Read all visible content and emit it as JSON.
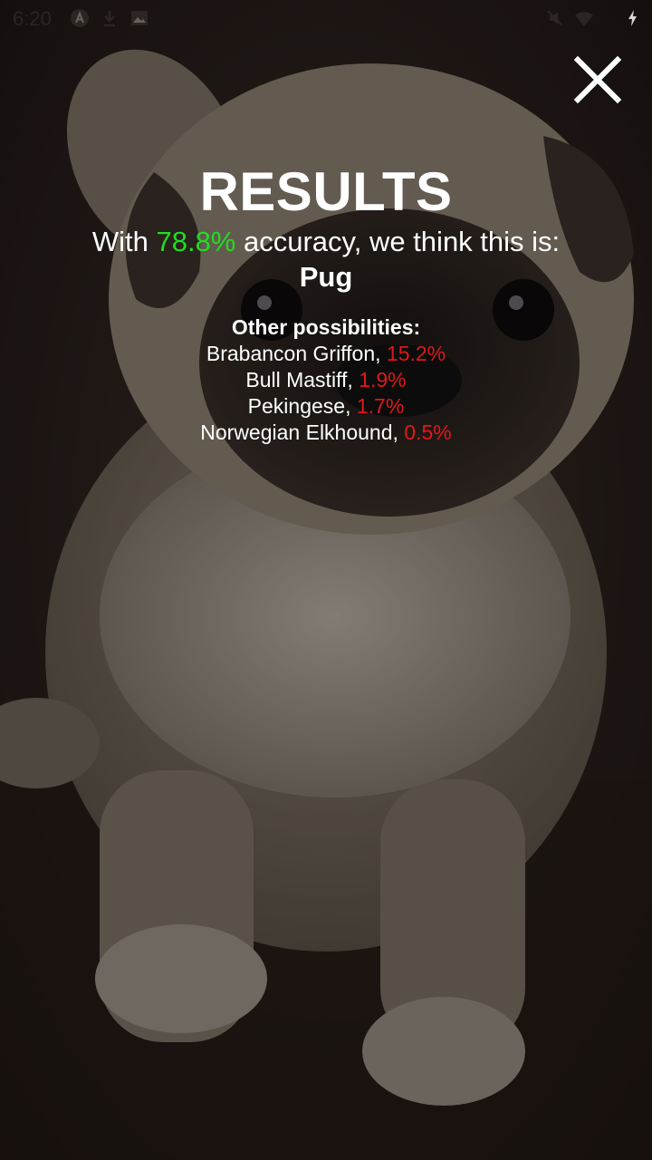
{
  "status_bar": {
    "time": "6:20",
    "left_icons": [
      "app-a-icon",
      "download-icon",
      "image-icon"
    ],
    "right_icons": [
      "mute-icon",
      "wifi-icon",
      "battery-charging-icon"
    ]
  },
  "close_icon": "close-icon",
  "results": {
    "title": "RESULTS",
    "accuracy_prefix": "With ",
    "accuracy_value": "78.8%",
    "accuracy_suffix": " accuracy, we think this is:",
    "breed": "Pug",
    "other_heading": "Other possibilities:",
    "possibilities": [
      {
        "name": "Brabancon Griffon, ",
        "percent": "15.2%"
      },
      {
        "name": "Bull Mastiff, ",
        "percent": "1.9%"
      },
      {
        "name": "Pekingese, ",
        "percent": "1.7%"
      },
      {
        "name": "Norwegian Elkhound, ",
        "percent": "0.5%"
      }
    ]
  },
  "colors": {
    "accuracy": "#22dd22",
    "percent": "#e01818",
    "text": "#ffffff"
  }
}
